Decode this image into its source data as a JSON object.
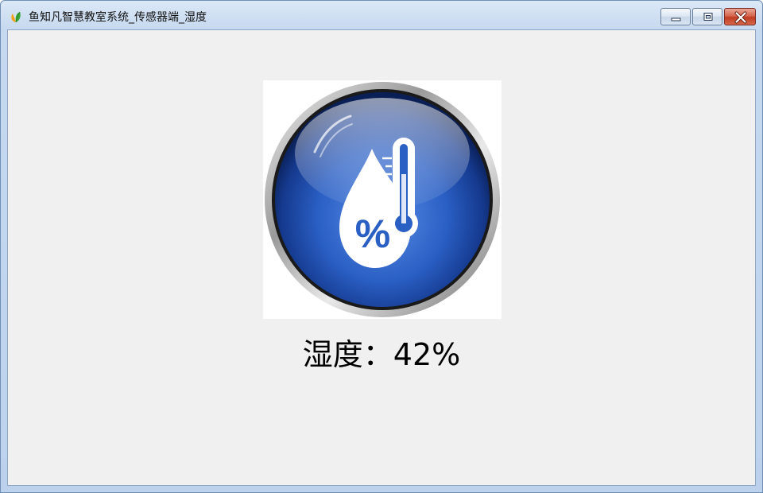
{
  "window": {
    "title": "鱼知凡智慧教室系统_传感器端_湿度",
    "icon": "leaf-app-icon",
    "controls": [
      "minimize-icon",
      "restore-icon",
      "close-icon"
    ]
  },
  "sensor": {
    "icon": "humidity-thermometer-icon",
    "icon_percent_glyph": "%",
    "label": "湿度",
    "separator": "：",
    "value": "42%"
  },
  "colors": {
    "client_background": "#f0f0f0",
    "badge_blue": "#2a5fc4",
    "close_red": "#c8452c"
  }
}
